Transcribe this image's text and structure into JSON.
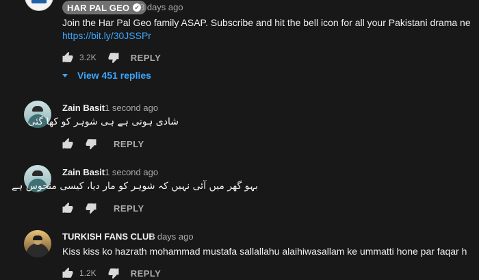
{
  "comments": [
    {
      "badge_label": "HAR PAL GEO",
      "check_glyph": "✔",
      "time": "3 days ago",
      "text": "Join the Har Pal Geo family ASAP. Subscribe and hit the bell icon for all your Pakistani drama ne",
      "link": "https://bit.ly/30JSSPr",
      "likes": "3.2K",
      "reply_label": "REPLY",
      "view_replies": "View 451 replies",
      "avatar_icon": "channel-logo"
    },
    {
      "author": "Zain Basit",
      "time": "1 second ago",
      "text": "شادی ہوتی ہے ہی شوہر کو کھا گئی",
      "reply_label": "REPLY",
      "avatar_icon": "user-avatar"
    },
    {
      "author": "Zain Basit",
      "time": "1 second ago",
      "text": "بہو گھر میں آئی نہیں کہ شوہر کو مار دیا، کیسی منحوس ہے",
      "reply_label": "REPLY",
      "avatar_icon": "user-avatar"
    },
    {
      "author": "TURKISH FANS CLUB",
      "time": "3 days ago",
      "text": "Kiss kiss ko hazrath mohammad mustafa sallallahu alaihiwasallam ke ummatti hone par faqar h",
      "likes": "1.2K",
      "reply_label": "REPLY",
      "avatar_icon": "user-avatar"
    }
  ],
  "colors": {
    "background": "#181818",
    "text": "#f1f1f1",
    "secondary": "#aaaaaa",
    "link": "#3ea6ff",
    "badge": "#717171"
  },
  "icons": [
    "thumbs-up-icon",
    "thumbs-down-icon",
    "check-icon",
    "caret-down-icon"
  ]
}
